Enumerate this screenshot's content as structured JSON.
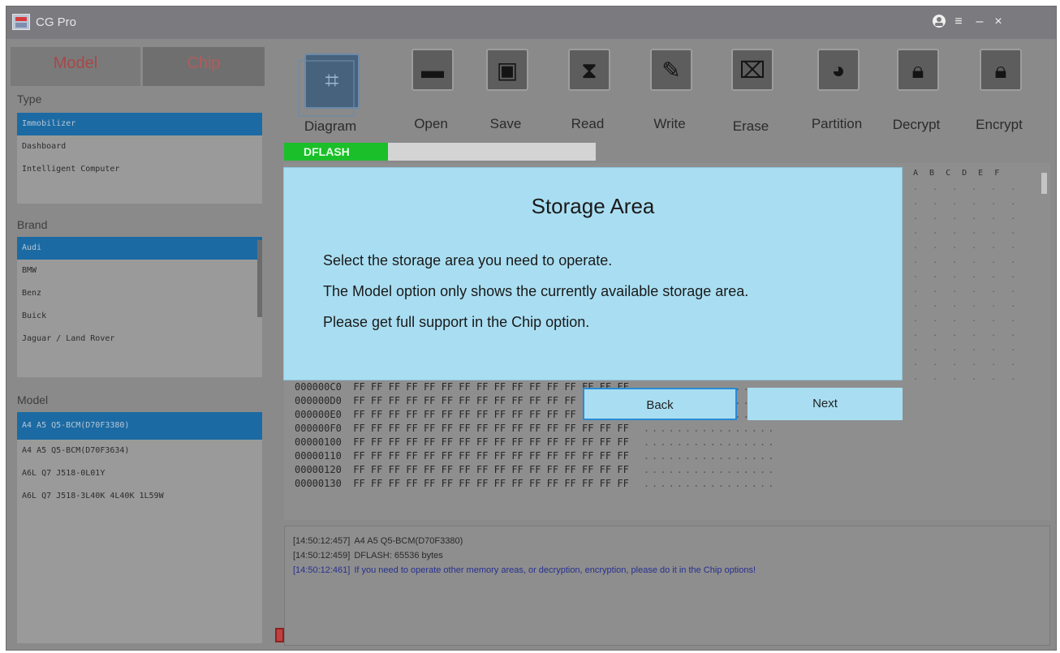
{
  "app": {
    "title": "CG Pro"
  },
  "left": {
    "tabs": [
      "Model",
      "Chip"
    ],
    "type_label": "Type",
    "type_items": [
      "Immobilizer",
      "Dashboard",
      "Intelligent Computer"
    ],
    "brand_label": "Brand",
    "brand_items": [
      "Audi",
      "BMW",
      "Benz",
      "Buick",
      "Jaguar / Land Rover"
    ],
    "model_label": "Model",
    "model_items": [
      "A4 A5 Q5-BCM(D70F3380)",
      "A4 A5 Q5-BCM(D70F3634)",
      "A6L Q7 J518-0L01Y",
      "A6L Q7 J518-3L40K 4L40K 1L59W"
    ]
  },
  "toolbar": {
    "buttons": [
      "Diagram",
      "Open",
      "Save",
      "Read",
      "Write",
      "Erase",
      "Partition",
      "Decrypt",
      "Encrypt"
    ]
  },
  "progress": {
    "label": "DFLASH",
    "fraction": 0.0
  },
  "hex": {
    "header": "A B C D E F",
    "rows": [
      {
        "addr": "000000C0",
        "bytes": "FF FF FF FF FF FF FF FF FF FF FF FF FF FF FF FF",
        "ascii": "................"
      },
      {
        "addr": "000000D0",
        "bytes": "FF FF FF FF FF FF FF FF FF FF FF FF FF FF FF FF",
        "ascii": "................"
      },
      {
        "addr": "000000E0",
        "bytes": "FF FF FF FF FF FF FF FF FF FF FF FF FF FF FF FF",
        "ascii": "................"
      },
      {
        "addr": "000000F0",
        "bytes": "FF FF FF FF FF FF FF FF FF FF FF FF FF FF FF FF",
        "ascii": "................"
      },
      {
        "addr": "00000100",
        "bytes": "FF FF FF FF FF FF FF FF FF FF FF FF FF FF FF FF",
        "ascii": "................"
      },
      {
        "addr": "00000110",
        "bytes": "FF FF FF FF FF FF FF FF FF FF FF FF FF FF FF FF",
        "ascii": "................"
      },
      {
        "addr": "00000120",
        "bytes": "FF FF FF FF FF FF FF FF FF FF FF FF FF FF FF FF",
        "ascii": "................"
      },
      {
        "addr": "00000130",
        "bytes": "FF FF FF FF FF FF FF FF FF FF FF FF FF FF FF FF",
        "ascii": "................"
      }
    ],
    "dots": ". . . . . ."
  },
  "dialog": {
    "title": "Storage Area",
    "lines": [
      "Select the storage area you need to operate.",
      "The Model option only shows the currently available storage area.",
      "Please get full support in the Chip option."
    ],
    "back_label": "Back",
    "next_label": "Next"
  },
  "log": [
    {
      "time": "[14:50:12:457]",
      "text": "A4  A5  Q5-BCM(D70F3380)",
      "highlight": false
    },
    {
      "time": "[14:50:12:459]",
      "text": "DFLASH:  65536  bytes",
      "highlight": false
    },
    {
      "time": "[14:50:12:461]",
      "text": "If  you  need  to  operate  other  memory  areas,  or  decryption,  encryption,  please  do  it  in  the  Chip  options!",
      "highlight": true
    }
  ],
  "icons": {
    "user": "user-icon",
    "menu": "menu-icon",
    "minimize": "minimize-icon",
    "close": "close-icon"
  }
}
